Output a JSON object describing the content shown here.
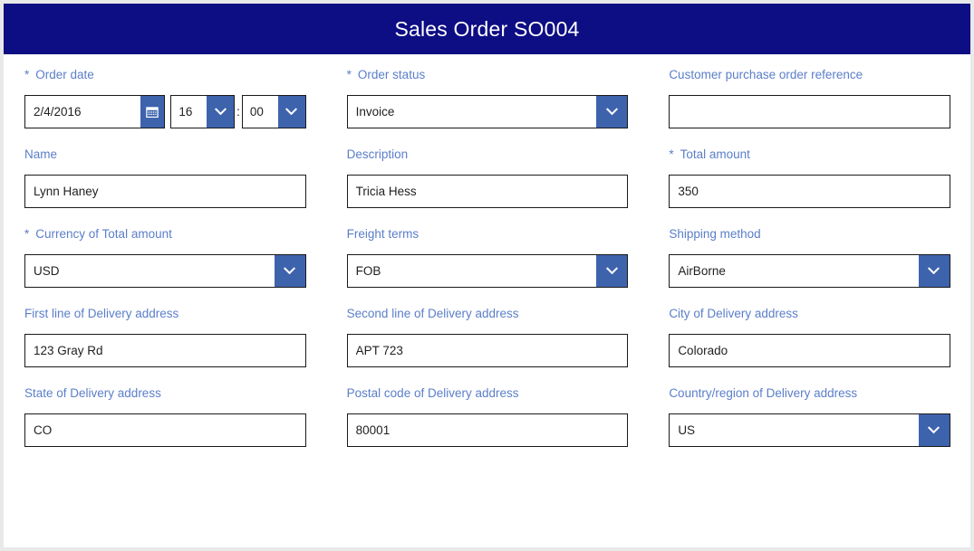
{
  "header": {
    "title": "Sales Order SO004",
    "background_color": "#0d0d84",
    "text_color": "#ffffff"
  },
  "theme": {
    "label_color": "#5b7ec9",
    "control_accent": "#3e63ad",
    "border_color": "#1a1a1a",
    "page_background": "#e9e9e9",
    "card_background": "#ffffff"
  },
  "form": {
    "rows": [
      {
        "fields": [
          {
            "name": "order-date",
            "label": "Order date",
            "required_marker": "*",
            "type": "datetime",
            "date_value": "2/4/2016",
            "hour_value": "16",
            "time_separator": ":",
            "minute_value": "00",
            "calendar_icon": "calendar-icon"
          },
          {
            "name": "order-status",
            "label": "Order status",
            "required_marker": "*",
            "type": "combobox",
            "value": "Invoice"
          },
          {
            "name": "customer-purchase-order-reference",
            "label": "Customer purchase order reference",
            "required_marker": "",
            "type": "textbox",
            "value": "",
            "placeholder": ""
          }
        ]
      },
      {
        "fields": [
          {
            "name": "name",
            "label": "Name",
            "required_marker": "",
            "type": "textbox",
            "value": "Lynn Haney",
            "placeholder": ""
          },
          {
            "name": "description",
            "label": "Description",
            "required_marker": "",
            "type": "textbox",
            "value": "Tricia Hess",
            "placeholder": ""
          },
          {
            "name": "total-amount",
            "label": "Total amount",
            "required_marker": "*",
            "type": "textbox",
            "value": "350",
            "placeholder": ""
          }
        ]
      },
      {
        "fields": [
          {
            "name": "currency-of-total-amount",
            "label": "Currency of Total amount",
            "required_marker": "*",
            "type": "combobox",
            "value": "USD"
          },
          {
            "name": "freight-terms",
            "label": "Freight terms",
            "required_marker": "",
            "type": "combobox",
            "value": "FOB"
          },
          {
            "name": "shipping-method",
            "label": "Shipping method",
            "required_marker": "",
            "type": "combobox",
            "value": "AirBorne"
          }
        ]
      },
      {
        "fields": [
          {
            "name": "first-line-of-delivery-address",
            "label": "First line of Delivery address",
            "required_marker": "",
            "type": "textbox",
            "value": "123 Gray Rd",
            "placeholder": ""
          },
          {
            "name": "second-line-of-delivery-address",
            "label": "Second line of Delivery address",
            "required_marker": "",
            "type": "textbox",
            "value": "APT 723",
            "placeholder": ""
          },
          {
            "name": "city-of-delivery-address",
            "label": "City of Delivery address",
            "required_marker": "",
            "type": "textbox",
            "value": "Colorado",
            "placeholder": ""
          }
        ]
      },
      {
        "fields": [
          {
            "name": "state-of-delivery-address",
            "label": "State of Delivery address",
            "required_marker": "",
            "type": "textbox",
            "value": "CO",
            "placeholder": ""
          },
          {
            "name": "postal-code-of-delivery-address",
            "label": "Postal code of Delivery address",
            "required_marker": "",
            "type": "textbox",
            "value": "80001",
            "placeholder": ""
          },
          {
            "name": "country-region-of-delivery-address",
            "label": "Country/region of Delivery address",
            "required_marker": "",
            "type": "combobox",
            "value": "US"
          }
        ]
      }
    ]
  }
}
